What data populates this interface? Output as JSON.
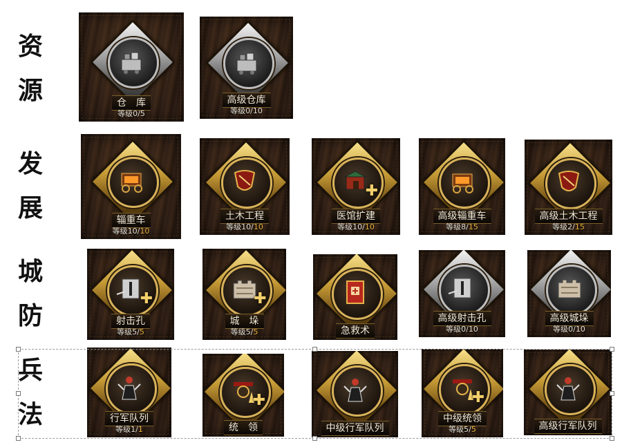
{
  "categories": [
    {
      "id": "resource",
      "title": "资\n源",
      "tiles": [
        {
          "name": "仓　库",
          "level": "等级0/",
          "max": "5",
          "style": "silver",
          "icon": "warehouse-icon"
        },
        {
          "name": "高级仓库",
          "level": "等级0/",
          "max": "10",
          "style": "silver",
          "icon": "warehouse-icon"
        }
      ]
    },
    {
      "id": "develop",
      "title": "发\n展",
      "tiles": [
        {
          "name": "辎重车",
          "level": "等级10/",
          "max": "10",
          "style": "gold",
          "icon": "wagon-icon"
        },
        {
          "name": "土木工程",
          "level": "等级10/",
          "max": "10",
          "style": "gold",
          "icon": "shield-icon"
        },
        {
          "name": "医馆扩建",
          "level": "等级10/",
          "max": "10",
          "style": "gold",
          "icon": "clinic-icon"
        },
        {
          "name": "高级辎重车",
          "level": "等级8/",
          "max": "15",
          "style": "gold",
          "icon": "wagon-icon"
        },
        {
          "name": "高级土木工程",
          "level": "等级2/",
          "max": "15",
          "style": "gold",
          "icon": "shield-icon"
        }
      ]
    },
    {
      "id": "defense",
      "title": "城\n防",
      "tiles": [
        {
          "name": "射击孔",
          "level": "等级5/",
          "max": "5",
          "style": "gold",
          "icon": "arrow-slit-icon"
        },
        {
          "name": "城　垛",
          "level": "等级5/",
          "max": "5",
          "style": "gold",
          "icon": "battlement-icon"
        },
        {
          "name": "急救术",
          "level": "",
          "max": "",
          "style": "gold",
          "icon": "first-aid-book-icon"
        },
        {
          "name": "高级射击孔",
          "level": "等级0/",
          "max": "10",
          "style": "silver",
          "icon": "arrow-slit-icon"
        },
        {
          "name": "高级城垛",
          "level": "等级0/",
          "max": "10",
          "style": "silver",
          "icon": "battlement-icon"
        }
      ]
    },
    {
      "id": "tactics",
      "title": "兵\n法",
      "tiles": [
        {
          "name": "行军队列",
          "level": "等级1/",
          "max": "1",
          "style": "gold",
          "icon": "warrior-icon"
        },
        {
          "name": "统　领",
          "level": "",
          "max": "",
          "style": "gold",
          "icon": "commander-icon"
        },
        {
          "name": "中级行军队列",
          "level": "",
          "max": "",
          "style": "gold",
          "icon": "warrior-icon"
        },
        {
          "name": "中级统领",
          "level": "等级5/",
          "max": "5",
          "style": "gold",
          "icon": "commander-icon"
        },
        {
          "name": "高级行军队列",
          "level": "",
          "max": "",
          "style": "gold",
          "icon": "warrior-icon"
        }
      ]
    }
  ],
  "colors": {
    "accent_gold": "#e9b33f",
    "label_text": "#f3ead6",
    "background": "#ffffff"
  }
}
